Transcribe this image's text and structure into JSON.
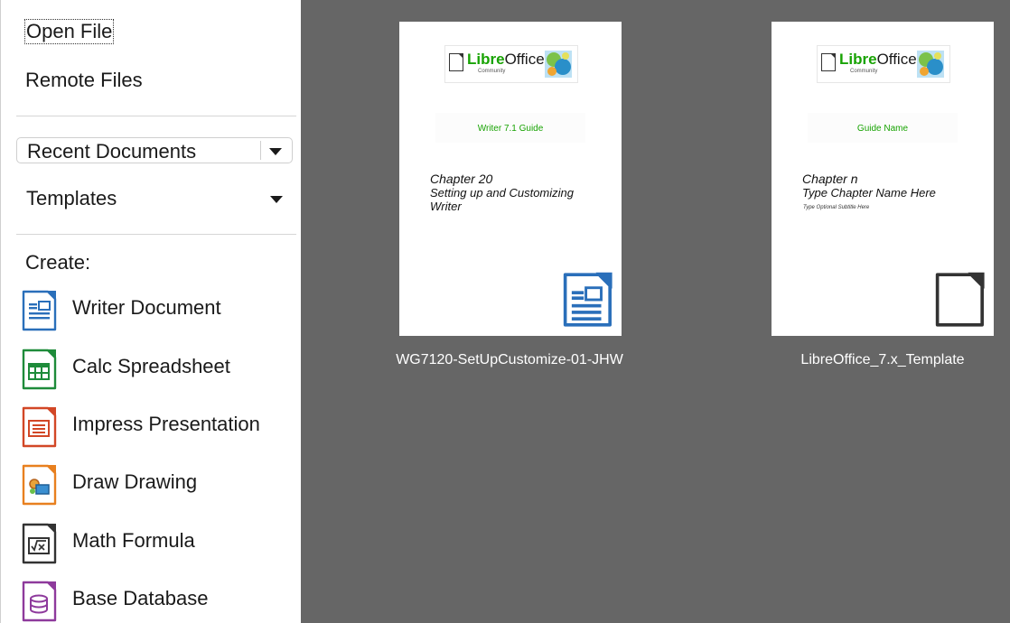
{
  "sidebar": {
    "open_file": "Open File",
    "remote_files": "Remote Files",
    "recent_documents": "Recent Documents",
    "templates": "Templates",
    "create_label": "Create:",
    "create_items": [
      {
        "label": "Writer Document",
        "icon": "writer-document-icon",
        "color": "#2a6fba"
      },
      {
        "label": "Calc Spreadsheet",
        "icon": "calc-spreadsheet-icon",
        "color": "#1e8b3a"
      },
      {
        "label": "Impress Presentation",
        "icon": "impress-presentation-icon",
        "color": "#d24726"
      },
      {
        "label": "Draw Drawing",
        "icon": "draw-drawing-icon",
        "color": "#e8801f"
      },
      {
        "label": "Math Formula",
        "icon": "math-formula-icon",
        "color": "#333333"
      },
      {
        "label": "Base Database",
        "icon": "base-database-icon",
        "color": "#8e3a9c"
      }
    ]
  },
  "templates": [
    {
      "caption": "WG7120-SetUpCustomize-01-JHW",
      "logo_text_bold": "Libre",
      "logo_text": "Office",
      "logo_sub": "Community",
      "guide": "Writer 7.1 Guide",
      "chapter_lines": [
        "Chapter 20",
        "Setting up and Customizing",
        "Writer"
      ],
      "subtitle": "",
      "badge_icon": "writer-document-icon"
    },
    {
      "caption": "LibreOffice_7.x_Template",
      "logo_text_bold": "Libre",
      "logo_text": "Office",
      "logo_sub": "Community",
      "guide": "Guide Name",
      "chapter_lines": [
        "Chapter n",
        "Type Chapter Name Here"
      ],
      "subtitle": "Type Optional Subtitle Here",
      "badge_icon": "generic-document-icon"
    }
  ],
  "colors": {
    "content_bg": "#666666",
    "accent_green": "#18a303"
  }
}
